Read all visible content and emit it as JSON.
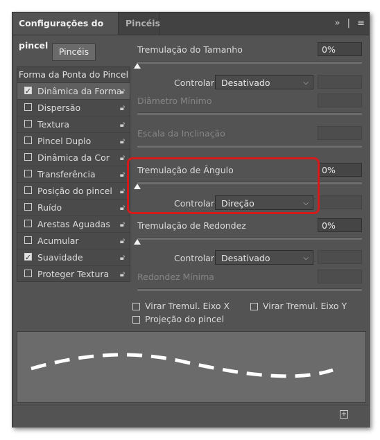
{
  "tabs": {
    "active": "Configurações do pincel",
    "inactive": "Pincéis",
    "tools": [
      "»",
      "|",
      "≡"
    ]
  },
  "brushes_button": "Pincéis",
  "list": {
    "header": "Forma da Ponta do Pincel",
    "items": [
      {
        "label": "Dinâmica da Forma",
        "checked": true
      },
      {
        "label": "Dispersão",
        "checked": false
      },
      {
        "label": "Textura",
        "checked": false
      },
      {
        "label": "Pincel Duplo",
        "checked": false
      },
      {
        "label": "Dinâmica da Cor",
        "checked": false
      },
      {
        "label": "Transferência",
        "checked": false
      },
      {
        "label": "Posição do pincel",
        "checked": false
      },
      {
        "label": "Ruído",
        "checked": false
      },
      {
        "label": "Arestas Aguadas",
        "checked": false
      },
      {
        "label": "Acumular",
        "checked": false
      },
      {
        "label": "Suavidade",
        "checked": true
      },
      {
        "label": "Proteger Textura",
        "checked": false
      }
    ]
  },
  "settings": {
    "size_jitter": {
      "label": "Tremulação do Tamanho",
      "value": "0%"
    },
    "size_control": {
      "label": "Controlar:",
      "value": "Desativado"
    },
    "min_diameter": {
      "label": "Diâmetro Mínimo"
    },
    "tilt_scale": {
      "label": "Escala da Inclinação"
    },
    "angle_jitter": {
      "label": "Tremulação de Ângulo",
      "value": "0%"
    },
    "angle_control": {
      "label": "Controlar:",
      "value": "Direção"
    },
    "roundness_jitter": {
      "label": "Tremulação de Redondez",
      "value": "0%"
    },
    "roundness_control": {
      "label": "Controlar:",
      "value": "Desativado"
    },
    "min_roundness": {
      "label": "Redondez Mínima"
    },
    "flip_x": {
      "label": "Virar Tremul. Eixo X",
      "checked": false
    },
    "flip_y": {
      "label": "Virar Tremul. Eixo Y",
      "checked": false
    },
    "brush_projection": {
      "label": "Projeção do pincel",
      "checked": false
    }
  },
  "colors": {
    "panel_bg": "#535353",
    "highlight": "#d41a1a"
  }
}
